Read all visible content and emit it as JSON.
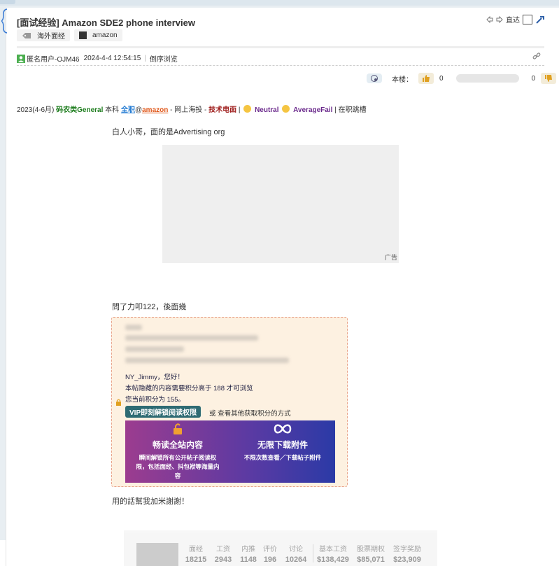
{
  "post": {
    "title": "[面试经验] Amazon SDE2 phone interview",
    "tags": [
      "海外面经",
      "amazon"
    ],
    "nav": {
      "direct_label": "直达"
    },
    "meta": {
      "author": "匿名用户-OJM46",
      "datetime": "2024-4-4 12:54:15",
      "reverse_label": "倒序浏览"
    },
    "vote": {
      "floor_label": "本楼：",
      "up_count": "0",
      "down_count": "0"
    }
  },
  "info": {
    "period": "2023(4-6月)",
    "category": "码农类General",
    "degree": "本科",
    "job_type": "全职",
    "at": "@",
    "company": "amazon",
    "sep1": " - ",
    "channel": "网上海投",
    "sep2": " - ",
    "interview_type": "技术电面",
    "sep3": " | ",
    "feeling": "Neutral",
    "result": "AverageFail",
    "status": "| 在职跳槽"
  },
  "content": {
    "para1": "白人小哥，面的是Advertising org",
    "ad_label": "广告",
    "para2": "問了力叩122，後面幾",
    "hidden": {
      "greeting": "NY_Jimmy，您好！",
      "requirement": "本帖隐藏的内容需要积分高于 188 才可浏览",
      "current": "您当前积分为 155。",
      "vip_button": "VIP即刻解锁阅读权限",
      "or_text": "或 查看其他获取积分的方式",
      "promo_left_title": "畅读全站内容",
      "promo_left_desc": "瞬间解锁所有公开帖子阅读权限，包括面经、抖包袱等海量内容",
      "promo_right_title": "无限下载附件",
      "promo_right_desc": "不限次数查看／下载帖子附件"
    },
    "para3": "用的話幫我加米謝謝！"
  },
  "company_card": {
    "stats": [
      {
        "label": "面经",
        "value": "18215"
      },
      {
        "label": "工资",
        "value": "2943"
      },
      {
        "label": "内推",
        "value": "1148"
      },
      {
        "label": "评价",
        "value": "196"
      },
      {
        "label": "讨论",
        "value": "10264"
      },
      {
        "label": "基本工资",
        "value": "$138,429"
      },
      {
        "label": "股票期权",
        "value": "$85,071"
      },
      {
        "label": "签字奖励",
        "value": "$23,909"
      }
    ]
  },
  "colors": {
    "category": "#1e7d1e",
    "job_type": "#2a7fd4",
    "company": "#e0591c",
    "interview_type": "#a0201f",
    "result": "#6b2a8c",
    "vip_button": "#2e6b73"
  }
}
